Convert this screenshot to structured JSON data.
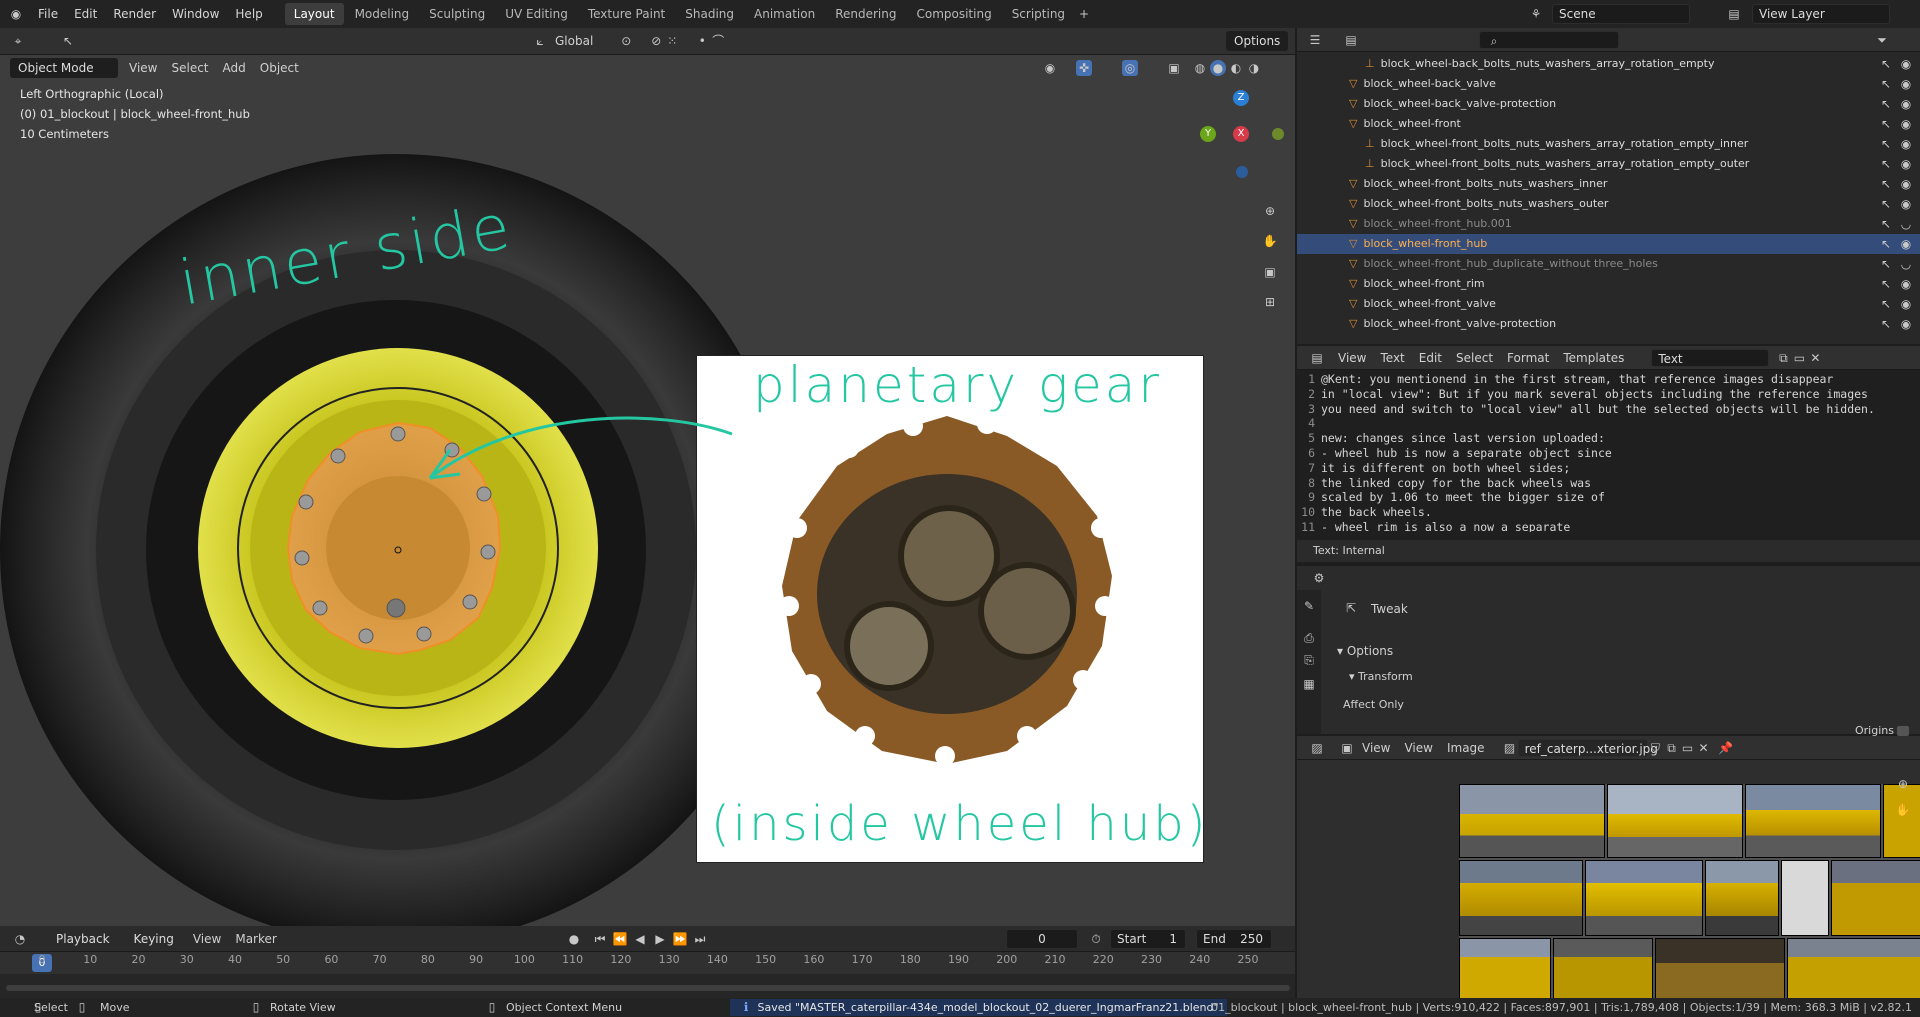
{
  "topbar": {
    "menus": [
      "File",
      "Edit",
      "Render",
      "Window",
      "Help"
    ],
    "workspaces": [
      "Layout",
      "Modeling",
      "Sculpting",
      "UV Editing",
      "Texture Paint",
      "Shading",
      "Animation",
      "Rendering",
      "Compositing",
      "Scripting"
    ],
    "active_workspace": "Layout",
    "scene": "Scene",
    "view_layer": "View Layer"
  },
  "viewport": {
    "transform_orientation": "Global",
    "options_label": "Options",
    "mode": "Object Mode",
    "menu": [
      "View",
      "Select",
      "Add",
      "Object"
    ],
    "info_view": "Left Orthographic (Local)",
    "info_object": "(0) 01_blockout | block_wheel-front_hub",
    "info_scale": "10 Centimeters",
    "gizmo": {
      "z": "Z",
      "y": "Y",
      "x": "X"
    },
    "annotations": {
      "inner_side": "inner side",
      "planetary": "planetary gear",
      "inside_hub": "(inside wheel hub)"
    }
  },
  "outliner": {
    "rows": [
      {
        "name": "block_wheel-back_bolts_nuts_washers_array_rotation_empty",
        "state": "empty"
      },
      {
        "name": "block_wheel-back_valve",
        "state": "normal"
      },
      {
        "name": "block_wheel-back_valve-protection",
        "state": "normal"
      },
      {
        "name": "block_wheel-front",
        "state": "normal"
      },
      {
        "name": "block_wheel-front_bolts_nuts_washers_array_rotation_empty_inner",
        "state": "empty"
      },
      {
        "name": "block_wheel-front_bolts_nuts_washers_array_rotation_empty_outer",
        "state": "empty"
      },
      {
        "name": "block_wheel-front_bolts_nuts_washers_inner",
        "state": "normal"
      },
      {
        "name": "block_wheel-front_bolts_nuts_washers_outer",
        "state": "normal"
      },
      {
        "name": "block_wheel-front_hub.001",
        "state": "dim"
      },
      {
        "name": "block_wheel-front_hub",
        "state": "selected"
      },
      {
        "name": "block_wheel-front_hub_duplicate_without three_holes",
        "state": "dim"
      },
      {
        "name": "block_wheel-front_rim",
        "state": "normal"
      },
      {
        "name": "block_wheel-front_valve",
        "state": "normal"
      },
      {
        "name": "block_wheel-front_valve-protection",
        "state": "normal"
      }
    ]
  },
  "text_editor": {
    "menu": [
      "View",
      "Text",
      "Edit",
      "Select",
      "Format",
      "Templates"
    ],
    "datablock": "Text",
    "footer": "Text: Internal",
    "lines": [
      "@Kent: you mentionend in the first stream, that reference images disappear",
      "in \"local view\": But if you mark several objects including the reference images",
      "you need and switch to \"local view\" all but the selected objects will be hidden.",
      "",
      "new: changes since last version uploaded:",
      "- wheel hub is now a separate object since",
      "it is different on both wheel sides;",
      "the linked copy for the back wheels was",
      "scaled by 1.06 to meet the bigger size of",
      "the back wheels.",
      "- wheel rim is also a now a separate"
    ]
  },
  "properties": {
    "tool": "Tweak",
    "options": "Options",
    "transform": "Transform",
    "affect_only": "Affect Only",
    "origins": "Origins"
  },
  "image_editor": {
    "menu": [
      "View",
      "View",
      "Image"
    ],
    "image_name": "ref_caterp...xterior.jpg"
  },
  "timeline": {
    "menu": [
      "Playback",
      "Keying",
      "View",
      "Marker"
    ],
    "current_frame": "0",
    "start_label": "Start",
    "start": "1",
    "end_label": "End",
    "end": "250",
    "ticks": [
      "0",
      "10",
      "20",
      "30",
      "40",
      "50",
      "60",
      "70",
      "80",
      "90",
      "100",
      "110",
      "120",
      "130",
      "140",
      "150",
      "160",
      "170",
      "180",
      "190",
      "200",
      "210",
      "220",
      "230",
      "240",
      "250"
    ]
  },
  "statusbar": {
    "select": "Select",
    "move": "Move",
    "rotate": "Rotate View",
    "context": "Object Context Menu",
    "saved": "Saved \"MASTER_caterpillar-434e_model_blockout_02_duerer_IngmarFranz21.blend\"",
    "stats": "01_blockout | block_wheel-front_hub | Verts:910,422 | Faces:897,901 | Tris:1,789,408 | Objects:1/39 | Mem: 368.3 MiB | v2.82.1"
  },
  "colors": {
    "accent": "#334c7a",
    "selected_text": "#ffb14d",
    "annotation": "#24c7a2",
    "rim": "#c8c81a",
    "hub": "#d6913a"
  }
}
